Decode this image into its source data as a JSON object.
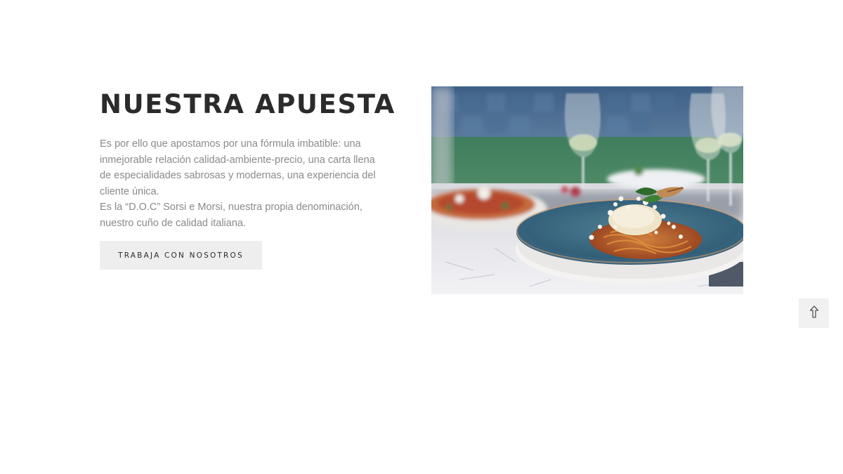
{
  "section": {
    "title": "NUESTRA APUESTA",
    "paragraphs": [
      "Es por ello que apostamos por una fórmula imbatible: una inmejorable relación calidad-ambiente-precio, una carta llena de especialidades sabrosas y modernas, una experiencia del cliente única.",
      "Es la “D.O.C” Sorsi e Morsi, nuestra propia denominación, nuestro cuño de calidad italiana."
    ],
    "cta_label": "TRABAJA CON NOSOTROS"
  },
  "image": {
    "subject": "pasta dish with grated cheese, pizza and wine glasses on a restaurant table"
  },
  "scroll_top": {
    "icon": "arrow-up-icon"
  },
  "colors": {
    "heading": "#2b2b2b",
    "body_text": "#8a8a8a",
    "button_bg": "#eeeeee",
    "scroll_bg": "#f1f1f1"
  }
}
